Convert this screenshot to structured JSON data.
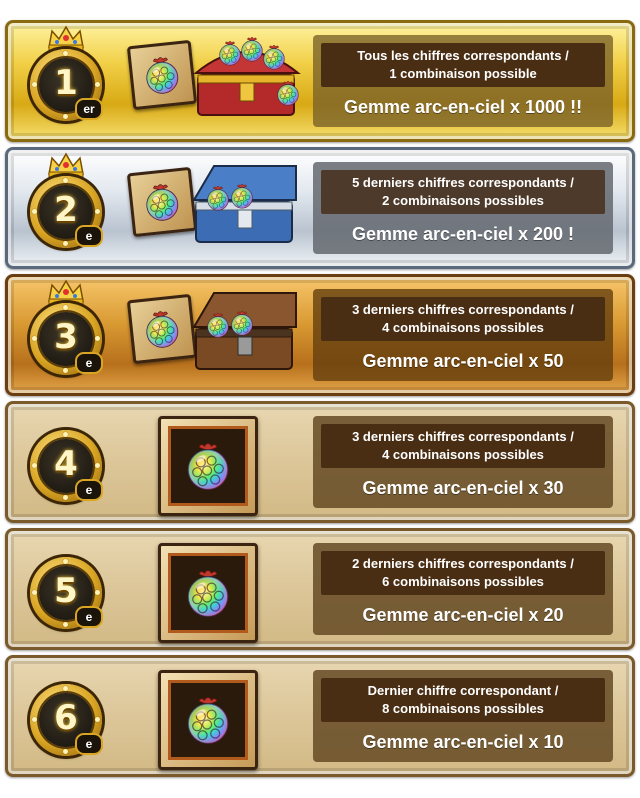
{
  "prizes": [
    {
      "rank": "1",
      "suffix": "er",
      "line1": "Tous les chiffres correspondants /",
      "line2": "1 combinaison possible",
      "reward": "Gemme arc-en-ciel x 1000 !!"
    },
    {
      "rank": "2",
      "suffix": "e",
      "line1": "5 derniers chiffres correspondants /",
      "line2": "2 combinaisons possibles",
      "reward": "Gemme arc-en-ciel x 200 !"
    },
    {
      "rank": "3",
      "suffix": "e",
      "line1": "3 derniers chiffres correspondants /",
      "line2": "4 combinaisons possibles",
      "reward": "Gemme arc-en-ciel x 50"
    },
    {
      "rank": "4",
      "suffix": "e",
      "line1": "3 derniers chiffres correspondants /",
      "line2": "4 combinaisons possibles",
      "reward": "Gemme arc-en-ciel x 30"
    },
    {
      "rank": "5",
      "suffix": "e",
      "line1": "2 derniers chiffres correspondants /",
      "line2": "6 combinaisons possibles",
      "reward": "Gemme arc-en-ciel x 20"
    },
    {
      "rank": "6",
      "suffix": "e",
      "line1": "Dernier chiffre correspondant /",
      "line2": "8 combinaisons possibles",
      "reward": "Gemme arc-en-ciel x 10"
    }
  ],
  "icons": {
    "crown": "crown-icon",
    "gem": "rainbow-gem-icon",
    "chest": "treasure-chest-icon"
  },
  "colors": {
    "gold": "#d8a915",
    "silver": "#b9c3cf",
    "bronze": "#b7701c",
    "parchment": "#dcc699"
  }
}
